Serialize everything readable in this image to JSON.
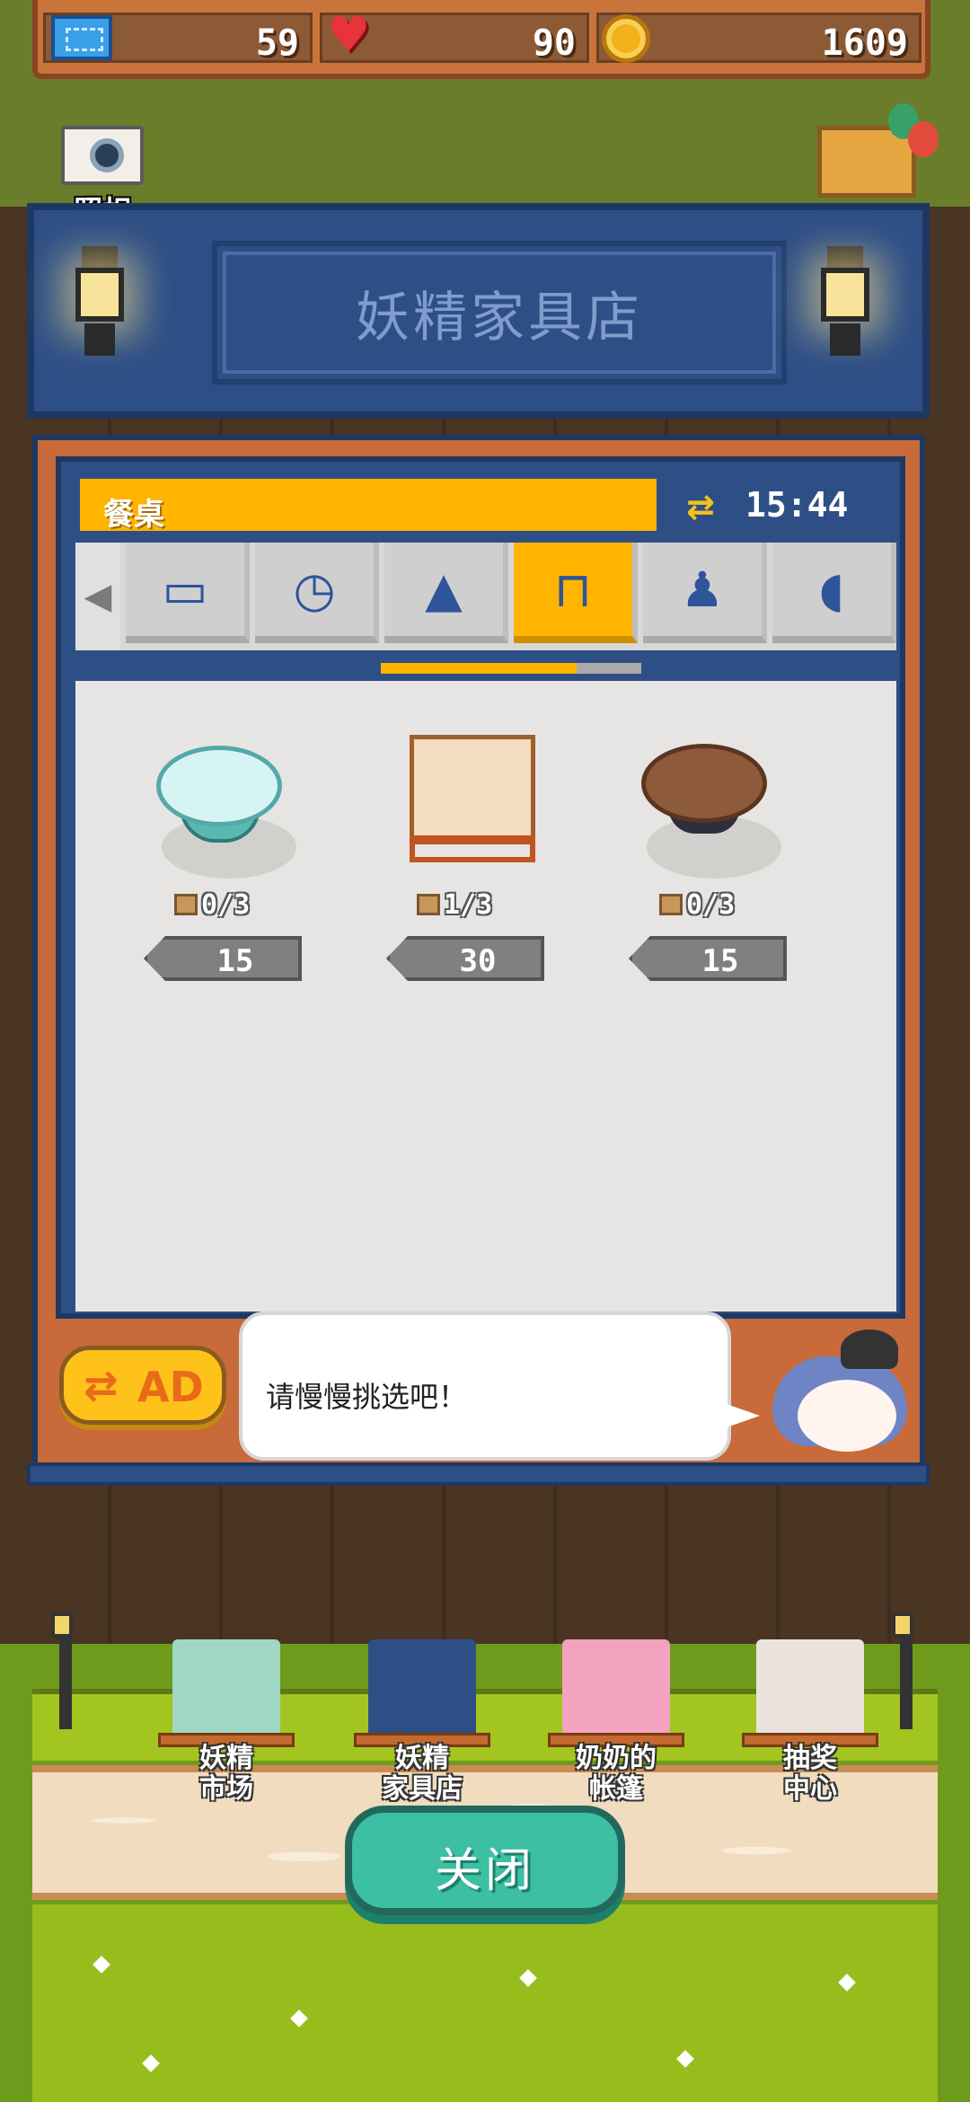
{
  "resources": {
    "tickets": "59",
    "hearts": "90",
    "coins": "1609"
  },
  "camera": {
    "label": "照相"
  },
  "shop": {
    "title": "妖精家具店",
    "category": "餐桌",
    "refresh_timer": "15:44",
    "tabs": [
      {
        "icon": "rug-icon",
        "glyph": "▭"
      },
      {
        "icon": "clock-icon",
        "glyph": "◷"
      },
      {
        "icon": "ceiling-lamp-icon",
        "glyph": "▲"
      },
      {
        "icon": "table-icon",
        "glyph": "⊓",
        "active": true
      },
      {
        "icon": "chair-icon",
        "glyph": "♟"
      },
      {
        "icon": "mirror-icon",
        "glyph": "◖"
      }
    ],
    "tab_scroll_progress": 0.75,
    "items": [
      {
        "name": "glass-round-table",
        "stock": "0/3",
        "price": "15"
      },
      {
        "name": "wooden-square-table",
        "stock": "1/3",
        "price": "30"
      },
      {
        "name": "dark-wood-round-table",
        "stock": "0/3",
        "price": "15"
      }
    ],
    "ad_button": {
      "label": "AD"
    },
    "dialog": "请慢慢挑选吧！"
  },
  "bottom_nav": [
    {
      "label": "妖精\n市场",
      "color": "#9fd9c4"
    },
    {
      "label": "妖精\n家具店",
      "color": "#2e4f86"
    },
    {
      "label": "奶奶的\n帐篷",
      "color": "#f3a2c0"
    },
    {
      "label": "抽奖\n中心",
      "color": "#e9e3dc"
    }
  ],
  "close_button": {
    "label": "关闭"
  },
  "colors": {
    "accent_yellow": "#ffb400",
    "shop_blue": "#2e4f86",
    "close_teal": "#3cbfa3"
  }
}
